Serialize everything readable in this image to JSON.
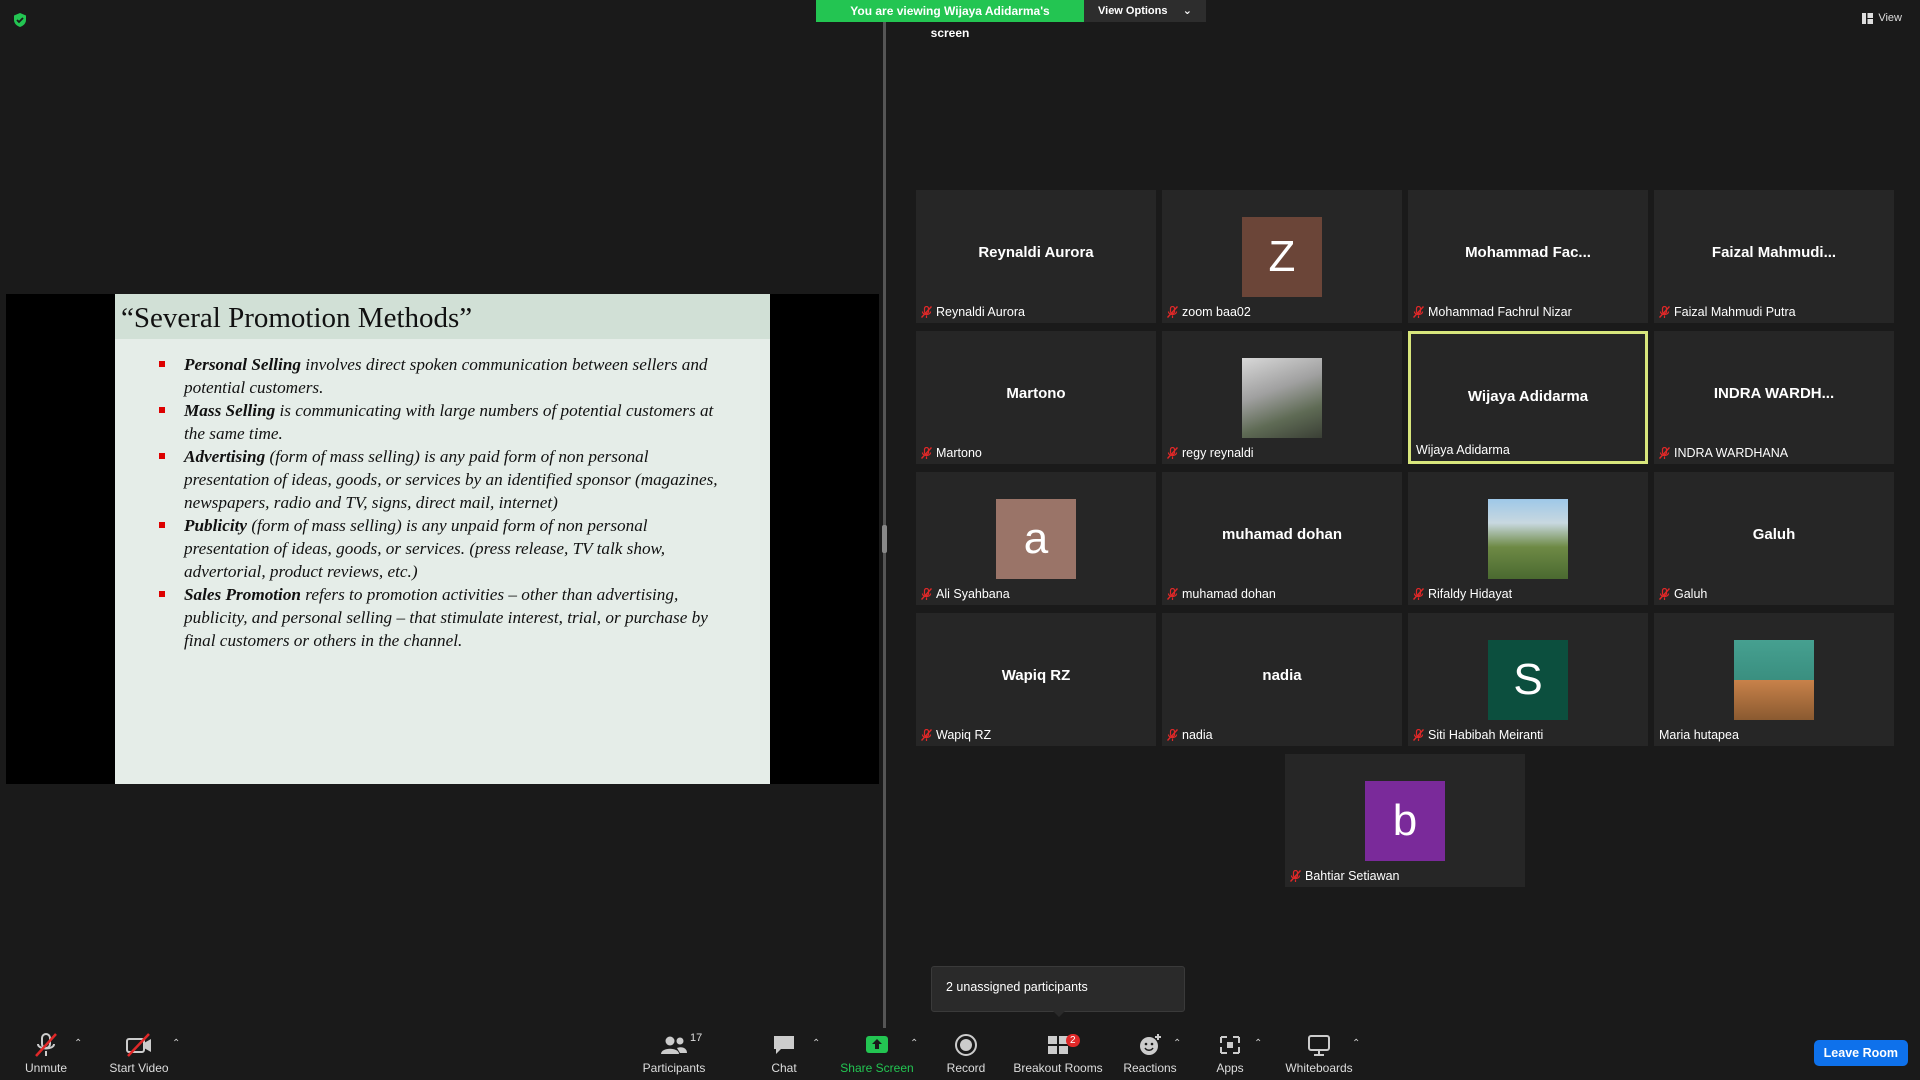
{
  "banner": {
    "viewing_text": "You are viewing Wijaya Adidarma's screen",
    "view_options_label": "View Options",
    "view_label": "View"
  },
  "slide": {
    "title": "“Several Promotion Methods”",
    "items": [
      {
        "term": "Personal Selling",
        "text": " involves direct spoken communication between sellers and potential customers."
      },
      {
        "term": "Mass Selling",
        "text": " is communicating with large numbers of potential customers at the same time."
      },
      {
        "term": "Advertising",
        "text": " (form of mass selling) is any paid form of non personal presentation of ideas, goods, or services by an identified sponsor (magazines, newspapers, radio and TV, signs, direct mail, internet)"
      },
      {
        "term": "Publicity",
        "text": " (form of mass selling) is any unpaid form of non personal presentation of ideas, goods, or services. (press release, TV talk show, advertorial, product reviews, etc.)"
      },
      {
        "term": "Sales Promotion",
        "text": " refers to promotion activities – other than advertising, publicity, and personal selling – that stimulate interest, trial, or purchase by final customers or others in the channel."
      }
    ]
  },
  "participants": [
    {
      "center": "Reynaldi Aurora",
      "label": "Reynaldi Aurora",
      "muted": true
    },
    {
      "avatar_letter": "Z",
      "avatar_color": "#6b4538",
      "label": "zoom baa02",
      "muted": true
    },
    {
      "center": "Mohammad  Fac...",
      "label": "Mohammad Fachrul Nizar",
      "muted": true
    },
    {
      "center": "Faizal  Mahmudi...",
      "label": "Faizal Mahmudi Putra",
      "muted": true
    },
    {
      "center": "Martono",
      "label": "Martono",
      "muted": true
    },
    {
      "photo": "photo1",
      "label": "regy reynaldi",
      "muted": true
    },
    {
      "center": "Wijaya Adidarma",
      "label": "Wijaya Adidarma",
      "muted": false,
      "active": true
    },
    {
      "center": "INDRA  WARDH...",
      "label": "INDRA WARDHANA",
      "muted": true
    },
    {
      "avatar_letter": "a",
      "avatar_color": "#9a7468",
      "label": "Ali Syahbana",
      "muted": true
    },
    {
      "center": "muhamad dohan",
      "label": "muhamad dohan",
      "muted": true
    },
    {
      "photo": "photo2",
      "label": "Rifaldy Hidayat",
      "muted": true
    },
    {
      "center": "Galuh",
      "label": "Galuh",
      "muted": true
    },
    {
      "center": "Wapiq RZ",
      "label": "Wapiq RZ",
      "muted": true
    },
    {
      "center": "nadia",
      "label": "nadia",
      "muted": true
    },
    {
      "avatar_letter": "S",
      "avatar_color": "#0c4f3e",
      "label": "Siti Habibah Meiranti",
      "muted": true
    },
    {
      "photo": "photo3",
      "label": "Maria hutapea",
      "muted": false
    },
    {
      "avatar_letter": "b",
      "avatar_color": "#7a2a9a",
      "label": "Bahtiar Setiawan",
      "muted": true
    }
  ],
  "tooltip": "2 unassigned participants",
  "toolbar": {
    "unmute": "Unmute",
    "start_video": "Start Video",
    "participants": "Participants",
    "participants_count": "17",
    "chat": "Chat",
    "share_screen": "Share Screen",
    "record": "Record",
    "breakout_rooms": "Breakout Rooms",
    "breakout_badge": "2",
    "reactions": "Reactions",
    "apps": "Apps",
    "whiteboards": "Whiteboards",
    "leave_room": "Leave Room"
  },
  "colors": {
    "share_green": "#23c552",
    "leave_blue": "#0e71eb",
    "active_border": "#d8e67c",
    "mute_red": "#e02828"
  }
}
